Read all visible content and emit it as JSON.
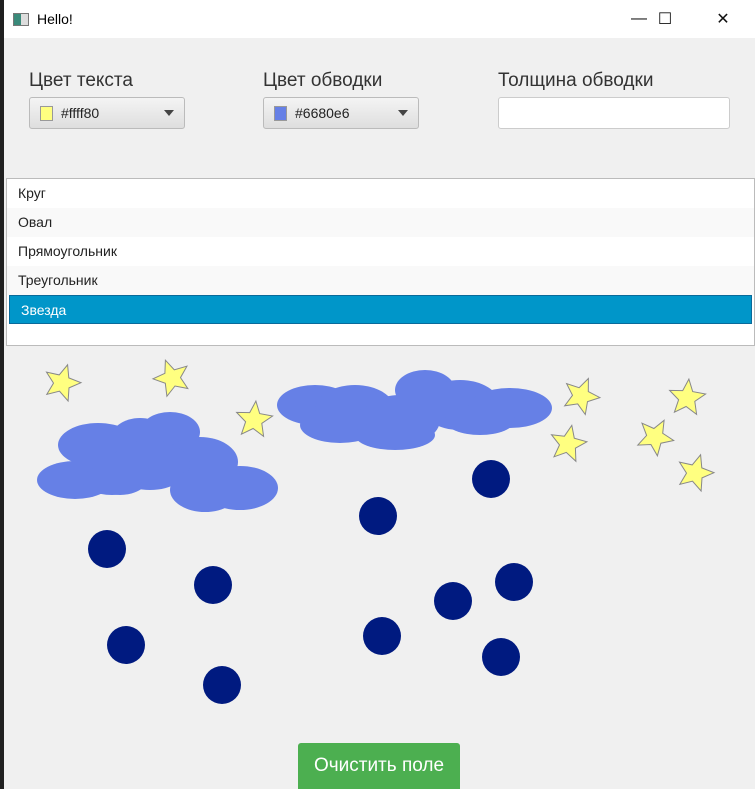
{
  "window": {
    "title": "Hello!",
    "minimize": "—",
    "maximize": "☐",
    "close": "✕"
  },
  "controls": {
    "text_color": {
      "label": "Цвет текста",
      "value": "#ffff80"
    },
    "stroke_color": {
      "label": "Цвет обводки",
      "value": "#6680e6"
    },
    "stroke_width": {
      "label": "Толщина обводки",
      "value": ""
    }
  },
  "shapes_list": {
    "items": [
      "Круг",
      "Овал",
      "Прямоугольник",
      "Треугольник",
      "Звезда"
    ],
    "selected": "Звезда"
  },
  "canvas": {
    "star_color": "#ffff80",
    "cloud_color": "#6680e6",
    "circle_color": "#001a80"
  },
  "clear_button": "Очистить поле"
}
